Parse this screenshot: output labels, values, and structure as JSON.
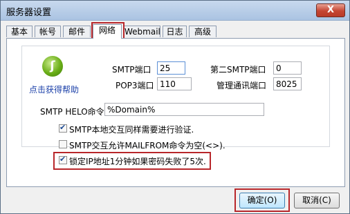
{
  "window": {
    "title": "服务器设置",
    "close_label": "X"
  },
  "tabs": [
    {
      "label": "基本",
      "active": false
    },
    {
      "label": "帐号",
      "active": false
    },
    {
      "label": "邮件",
      "active": false
    },
    {
      "label": "网络",
      "active": true
    },
    {
      "label": "Webmail",
      "active": false
    },
    {
      "label": "日志",
      "active": false
    },
    {
      "label": "高级",
      "active": false
    }
  ],
  "help": {
    "link_text": "点击获得帮助",
    "icon": "help-logo-icon"
  },
  "network": {
    "smtp_port": {
      "label": "SMTP端口",
      "value": "25"
    },
    "second_smtp_port": {
      "label": "第二SMTP端口",
      "value": "0"
    },
    "pop3_port": {
      "label": "POP3端口",
      "value": "110"
    },
    "admin_port": {
      "label": "管理通讯端口",
      "value": "8025"
    },
    "smtp_helo": {
      "label": "SMTP HELO命令",
      "value": "%Domain%"
    }
  },
  "options": [
    {
      "label": "SMTP本地交互同样需要进行验证.",
      "checked": true
    },
    {
      "label": "SMTP交互允许MAILFROM命令为空(<>).",
      "checked": false
    },
    {
      "label": "锁定IP地址1分钟如果密码失败了5次.",
      "checked": true
    }
  ],
  "buttons": {
    "ok": "确定(O)",
    "cancel": "取消(C)"
  },
  "colors": {
    "highlight": "#b8262a",
    "link": "#1a3fa8",
    "titlebar": "#aac3e2"
  }
}
